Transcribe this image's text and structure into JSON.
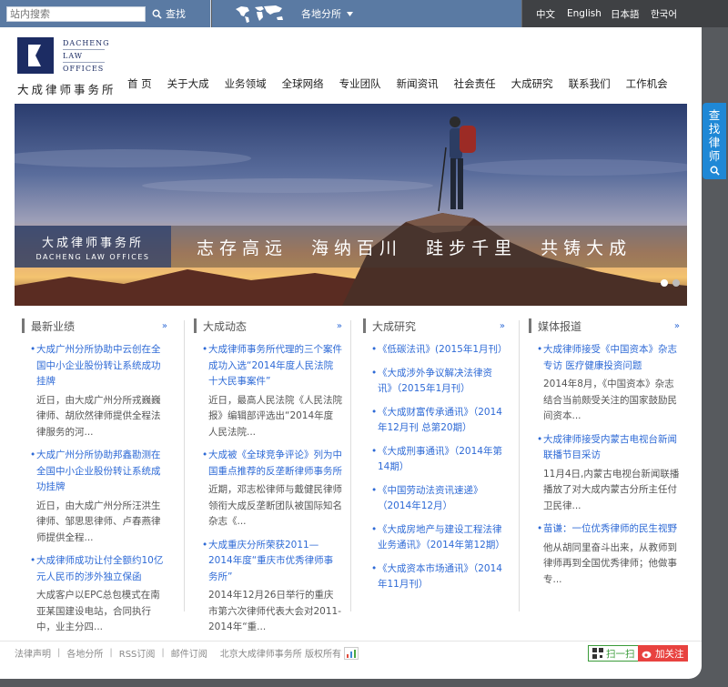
{
  "topbar": {
    "search_placeholder": "站内搜索",
    "search_button": "查找",
    "region_label": "各地分所",
    "languages": [
      "中文",
      "English",
      "日本語",
      "한국어"
    ]
  },
  "logo": {
    "en_lines": [
      "DACHENG",
      "LAW",
      "OFFICES"
    ],
    "cn": "大成律师事务所"
  },
  "nav": [
    "首 页",
    "关于大成",
    "业务领域",
    "全球网络",
    "专业团队",
    "新闻资讯",
    "社会责任",
    "大成研究",
    "联系我们",
    "工作机会"
  ],
  "banner": {
    "label_cn": "大成律师事务所",
    "label_en": "DACHENG LAW OFFICES",
    "slogan": "志存高远 海纳百川 跬步千里 共铸大成",
    "active_slide": 1,
    "slide_count": 2
  },
  "columns": [
    {
      "title": "最新业绩",
      "more": "»",
      "items": [
        {
          "title": "大成广州分所协助中云创在全国中小企业股份转让系统成功挂牌",
          "desc": "近日，由大成广州分所戎巍巍律师、胡欣然律师提供全程法律服务的河..."
        },
        {
          "title": "大成广州分所协助邦鑫勘测在全国中小企业股份转让系统成功挂牌",
          "desc": "近日，由大成广州分所汪洪生律师、邹思思律师、卢春燕律师提供全程..."
        },
        {
          "title": "大成律师成功让付全额约10亿元人民币的涉外独立保函",
          "desc": "大成客户以EPC总包模式在南亚某国建设电站，合同执行中，业主分四..."
        }
      ]
    },
    {
      "title": "大成动态",
      "more": "»",
      "items": [
        {
          "title": "大成律师事务所代理的三个案件成功入选“2014年度人民法院十大民事案件”",
          "desc": "近日，最高人民法院《人民法院报》编辑部评选出“2014年度人民法院..."
        },
        {
          "title": "大成被《全球竞争评论》列为中国重点推荐的反垄断律师事务所",
          "desc": "近期，邓志松律师与戴健民律师领衔大成反垄断团队被国际知名杂志《..."
        },
        {
          "title": "大成重庆分所荣获2011—2014年度“重庆市优秀律师事务所”",
          "desc": "2014年12月26日举行的重庆市第六次律师代表大会对2011-2014年“重..."
        }
      ]
    },
    {
      "title": "大成研究",
      "more": "»",
      "items": [
        {
          "title": "《低碳法讯》(2015年1月刊）",
          "desc": ""
        },
        {
          "title": "《大成涉外争议解决法律资讯》（2015年1月刊）",
          "desc": ""
        },
        {
          "title": "《大成财富传承通讯》（2014年12月刊 总第20期）",
          "desc": ""
        },
        {
          "title": "《大成刑事通讯》（2014年第14期）",
          "desc": ""
        },
        {
          "title": "《中国劳动法资讯速递》（2014年12月）",
          "desc": ""
        },
        {
          "title": "《大成房地产与建设工程法律业务通讯》（2014年第12期）",
          "desc": ""
        },
        {
          "title": "《大成资本市场通讯》（2014年11月刊）",
          "desc": ""
        }
      ]
    },
    {
      "title": "媒体报道",
      "more": "»",
      "items": [
        {
          "title": "大成律师接受《中国资本》杂志专访 医疗健康投资问题",
          "desc": "2014年8月，《中国资本》杂志结合当前颇受关注的国家鼓励民间资本..."
        },
        {
          "title": "大成律师接受内蒙古电视台新闻联播节目采访",
          "desc": "11月4日,内蒙古电视台新闻联播播放了对大成内蒙古分所主任付卫民律..."
        },
        {
          "title": "苗谦：一位优秀律师的民生视野",
          "desc": "他从胡同里奋斗出来，从教师到律师再到全国优秀律师；他做事专..."
        }
      ]
    }
  ],
  "footer": {
    "links": [
      "法律声明",
      "各地分所",
      "RSS订阅",
      "邮件订阅"
    ],
    "copyright": "北京大成律师事务所 版权所有",
    "scan_label": "扫一扫",
    "follow_label": "加关注"
  },
  "find_lawyer": "查找律师",
  "colors": {
    "topbar_blue": "#5a7aa3",
    "lang_bar": "#3f4144",
    "link_blue": "#2e6ad6",
    "logo_navy": "#1c2c63",
    "find_lawyer_blue": "#1f88d6",
    "wechat_green": "#3a9b39",
    "weibo_red": "#e8423f"
  }
}
